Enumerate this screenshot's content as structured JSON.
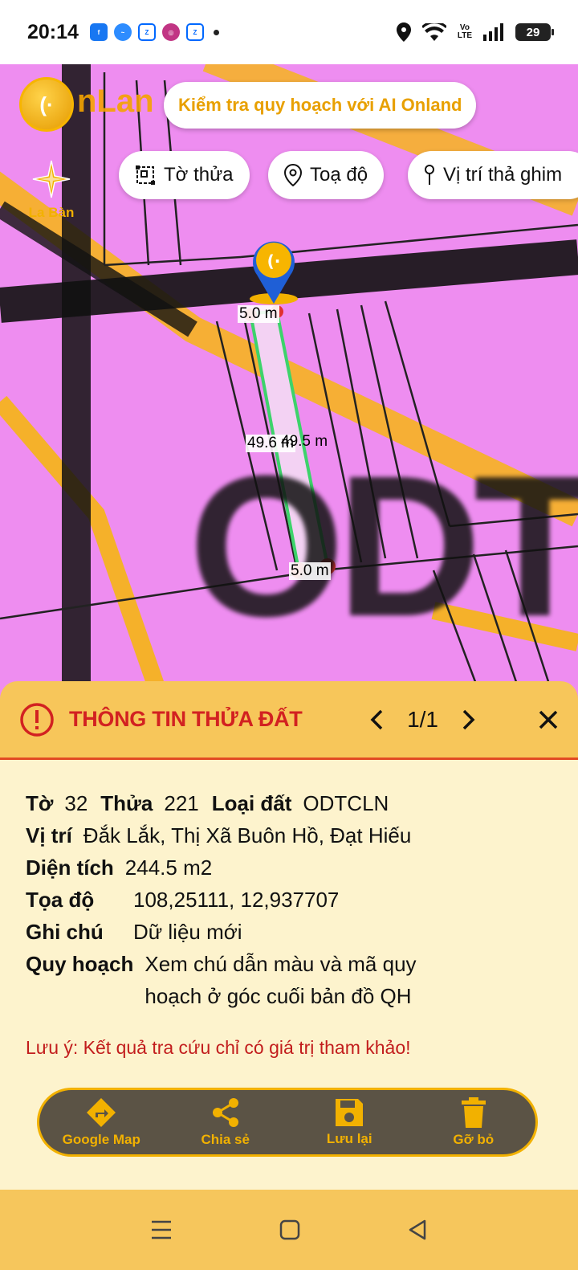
{
  "status_bar": {
    "time": "20:14",
    "battery": "29",
    "network": "LTE",
    "network_top": "Vo",
    "apps": [
      "facebook-icon",
      "messenger-icon",
      "zalo-icon",
      "instagram-icon",
      "zalo-icon"
    ]
  },
  "map": {
    "brand_text": "nLan",
    "check_button": "Kiểm tra quy hoạch với AI Onland",
    "compass_label": "La Bàn",
    "chips": [
      {
        "icon": "parcel-icon",
        "label": "Tờ thửa"
      },
      {
        "icon": "location-pin-icon",
        "label": "Toạ độ"
      },
      {
        "icon": "pin-icon",
        "label": "Vị trí thả ghim"
      }
    ],
    "measurements": {
      "top": "5.0 m",
      "left": "49.6 m",
      "right": "49.5 m",
      "bottom": "5.0 m"
    },
    "zone_code": "ODT"
  },
  "panel": {
    "title": "THÔNG TIN THỬA ĐẤT",
    "pager": "1/1",
    "fields": {
      "to_label": "Tờ",
      "to_value": "32",
      "thua_label": "Thửa",
      "thua_value": "221",
      "loai_label": "Loại đất",
      "loai_value": "ODTCLN",
      "vitri_label": "Vị trí",
      "vitri_value": "Đắk Lắk, Thị Xã Buôn Hồ, Đạt Hiếu",
      "dientich_label": "Diện tích",
      "dientich_value": "244.5 m2",
      "toado_label": "Tọa độ",
      "toado_value": "108,25111, 12,937707",
      "ghichu_label": "Ghi chú",
      "ghichu_value": "Dữ liệu mới",
      "quyhoach_label": "Quy hoạch",
      "quyhoach_value": "Xem chú dẫn màu và mã quy hoạch ở góc cuối bản đồ QH"
    },
    "note": "Lưu ý: Kết quả tra cứu chỉ có giá trị tham khảo!",
    "actions": [
      {
        "icon": "directions-icon",
        "label": "Google Map"
      },
      {
        "icon": "share-icon",
        "label": "Chia sẻ"
      },
      {
        "icon": "save-icon",
        "label": "Lưu lại"
      },
      {
        "icon": "trash-icon",
        "label": "Gỡ bỏ"
      }
    ]
  },
  "colors": {
    "map_background": "#ee8df0",
    "accent": "#f2b100",
    "alert": "#d22121"
  }
}
